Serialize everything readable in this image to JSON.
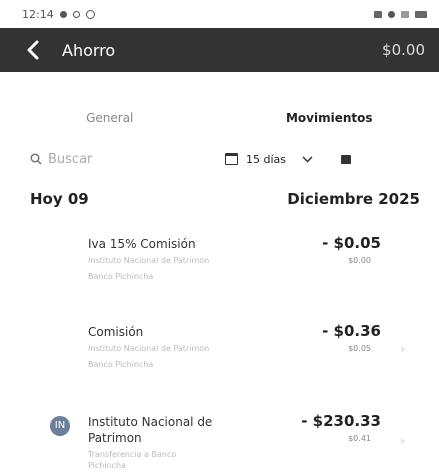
{
  "status": {
    "time": "12:14"
  },
  "header": {
    "title": "Ahorro",
    "amount": "$0.00"
  },
  "tabs": [
    {
      "label": "General",
      "active": false
    },
    {
      "label": "Movimientos",
      "active": true
    }
  ],
  "search": {
    "placeholder": "Buscar"
  },
  "filter": {
    "label": "15 días"
  },
  "date": {
    "left": "Hoy 09",
    "right": "Diciembre 2025"
  },
  "transactions": [
    {
      "title": "Iva 15% Comisión",
      "subtitle": "Instituto Nacional de Patrimon",
      "bank": "Banco Pichincha",
      "amount": "- $0.05",
      "balance": "$0.00"
    },
    {
      "title": "Comisión",
      "subtitle": "Instituto Nacional de Patrimon",
      "bank": "Banco Pichincha",
      "amount": "- $0.36",
      "balance": "$0.05"
    },
    {
      "avatar": "IN",
      "title": "Instituto Nacional de Patrimon",
      "subtitle": "Transferencia a Banco Pichincha",
      "amount": "- $230.33",
      "balance": "$0.41"
    }
  ],
  "colors": {
    "header_bg": "#333333",
    "accent_text": "#222222"
  }
}
